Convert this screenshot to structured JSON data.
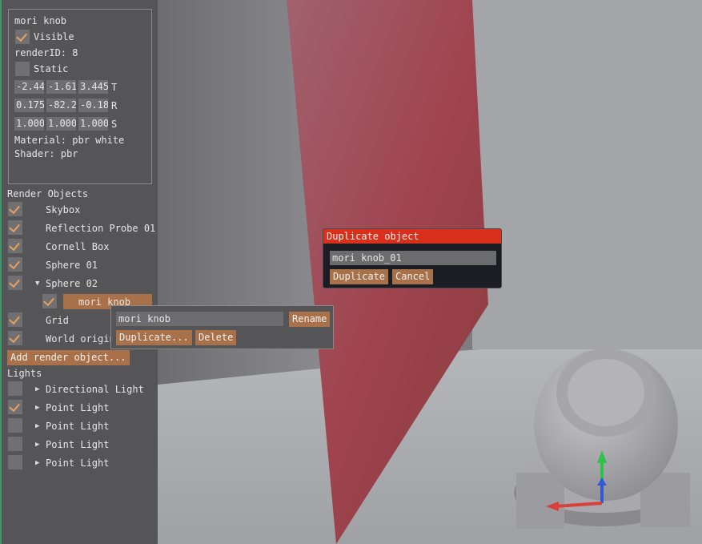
{
  "properties": {
    "object_name": "mori knob",
    "visible_label": "Visible",
    "visible_checked": true,
    "render_id": "renderID: 8",
    "static_label": "Static",
    "static_checked": false,
    "translate": [
      "-2.44",
      "-1.61",
      "3.445"
    ],
    "translate_label": "T",
    "rotate": [
      "0.175",
      "-82.2",
      "-0.18"
    ],
    "rotate_label": "R",
    "scale": [
      "1.000",
      "1.000",
      "1.000"
    ],
    "scale_label": "S",
    "material": "Material: pbr white",
    "shader": "Shader: pbr"
  },
  "render_objects": {
    "header": "Render Objects",
    "items": [
      {
        "label": "Skybox",
        "checked": true
      },
      {
        "label": "Reflection Probe 01",
        "checked": true
      },
      {
        "label": "Cornell Box",
        "checked": true
      },
      {
        "label": "Sphere 01",
        "checked": true
      },
      {
        "label": "Sphere 02",
        "checked": true
      },
      {
        "label": "mori knob",
        "checked": true
      },
      {
        "label": "Grid",
        "checked": true
      },
      {
        "label": "World origin",
        "checked": true
      }
    ],
    "add_button": "Add render object..."
  },
  "lights": {
    "header": "Lights",
    "items": [
      {
        "label": "Directional Light",
        "checked": false
      },
      {
        "label": "Point Light",
        "checked": true
      },
      {
        "label": "Point Light",
        "checked": false
      },
      {
        "label": "Point Light",
        "checked": false
      },
      {
        "label": "Point Light",
        "checked": false
      }
    ]
  },
  "context_menu": {
    "name_value": "mori knob",
    "rename_button": "Rename",
    "duplicate_button": "Duplicate...",
    "delete_button": "Delete"
  },
  "duplicate_dialog": {
    "title": "Duplicate object",
    "name_value": "mori knob_01",
    "duplicate_button": "Duplicate",
    "cancel_button": "Cancel"
  },
  "colors": {
    "accent": "#a9714a",
    "check": "#e8a060",
    "dialog_title": "#d9301c",
    "panel": "#555557"
  }
}
